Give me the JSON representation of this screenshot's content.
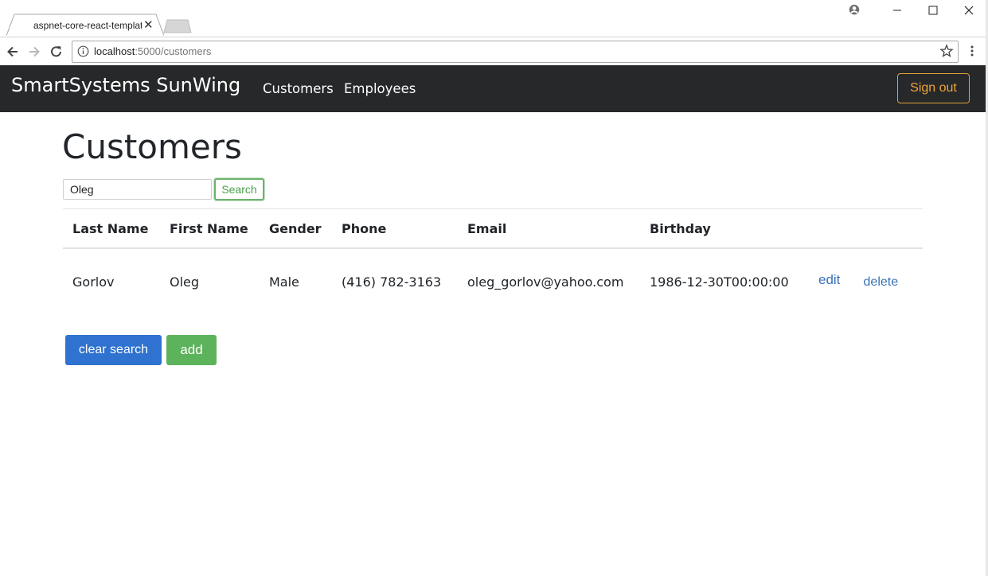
{
  "browser": {
    "tab_title": "aspnet-core-react-template",
    "url_host": "localhost",
    "url_rest": ":5000/customers"
  },
  "navbar": {
    "brand": "SmartSystems SunWing",
    "links": [
      "Customers",
      "Employees"
    ],
    "signout_label": "Sign out"
  },
  "page": {
    "title": "Customers",
    "search_value": "Oleg",
    "search_label": "Search"
  },
  "table": {
    "headers": [
      "Last Name",
      "First Name",
      "Gender",
      "Phone",
      "Email",
      "Birthday"
    ],
    "rows": [
      {
        "last_name": "Gorlov",
        "first_name": "Oleg",
        "gender": "Male",
        "phone": "(416) 782-3163",
        "email": "oleg_gorlov@yahoo.com",
        "birthday": "1986-12-30T00:00:00",
        "edit_label": "edit",
        "delete_label": "delete"
      }
    ]
  },
  "actions": {
    "clear_label": "clear search",
    "add_label": "add"
  },
  "colors": {
    "navbar_bg": "#262829",
    "signout": "#f0a43a",
    "primary": "#2f72cf",
    "success": "#5cb35c",
    "link": "#3a72b8"
  }
}
